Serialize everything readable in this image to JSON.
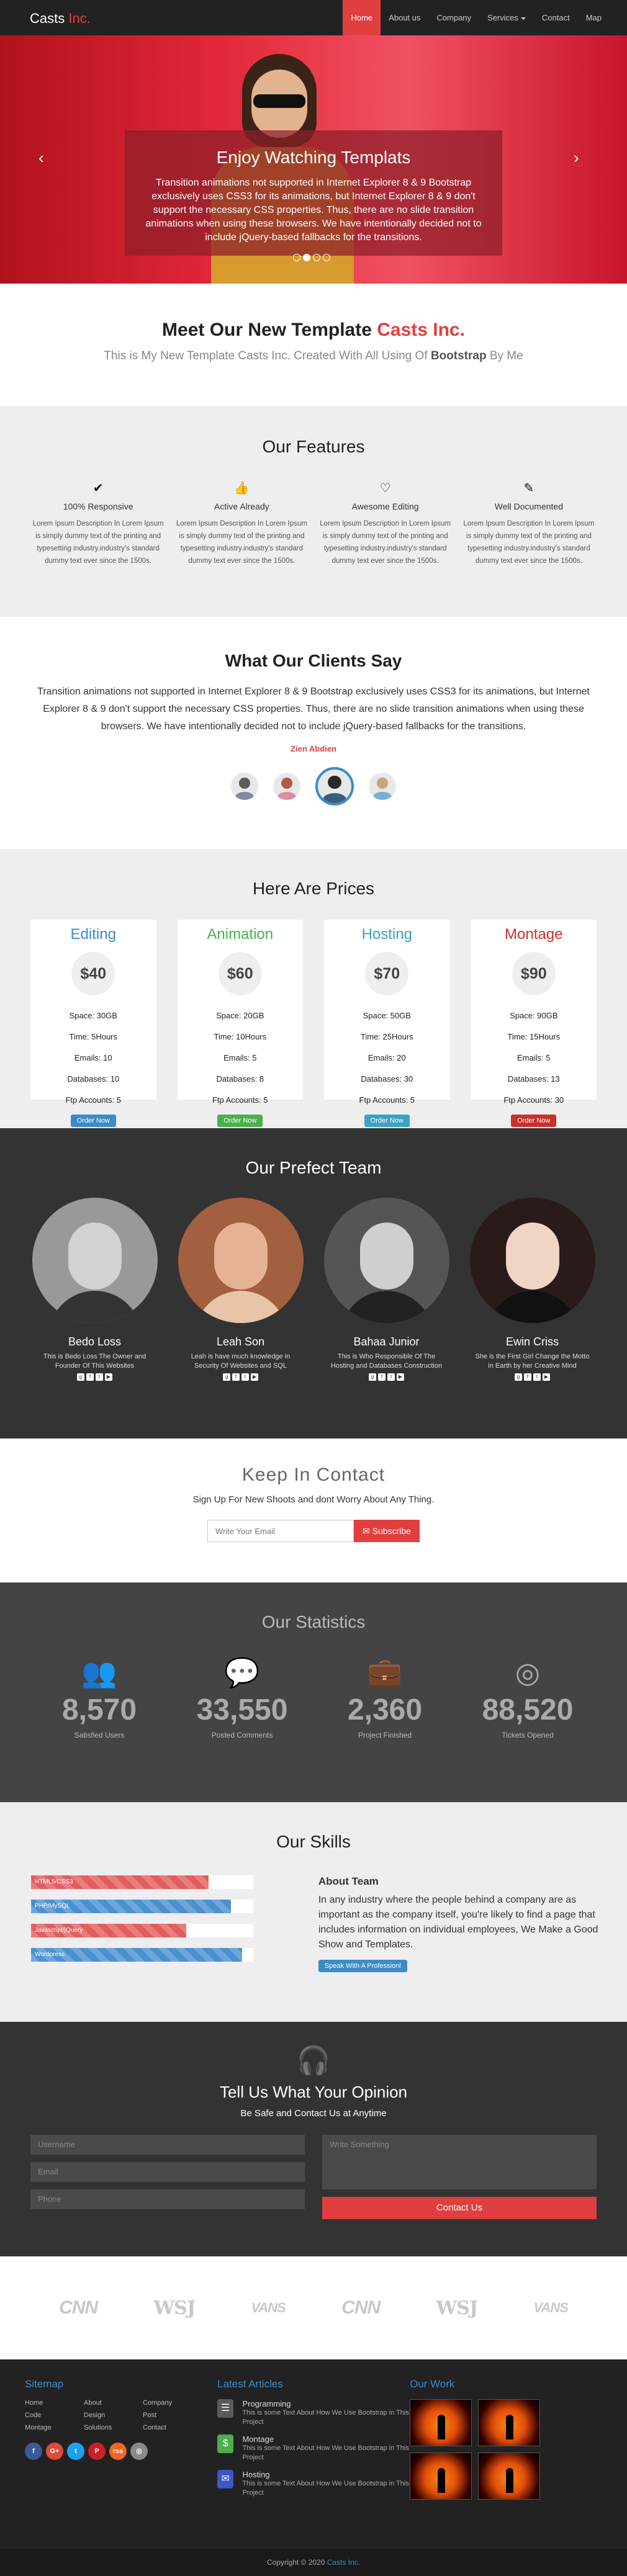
{
  "nav": {
    "brand_main": "Casts ",
    "brand_accent": "Inc.",
    "items": [
      "Home",
      "About us",
      "Company",
      "Services",
      "Contact",
      "Map"
    ]
  },
  "hero": {
    "title": "Enjoy Watching Templats",
    "text": "Transition animations not supported in Internet Explorer 8 & 9 Bootstrap exclusively uses CSS3 for its animations, but Internet Explorer 8 & 9 don't support the necessary CSS properties. Thus, there are no slide transition animations when using these browsers. We have intentionally decided not to include jQuery-based fallbacks for the transitions.",
    "prev": "‹",
    "next": "›"
  },
  "meet": {
    "title": "Meet Our New Template ",
    "title_accent": "Casts Inc.",
    "sub_a": "This is My New Template Casts Inc. Created With All Using Of ",
    "sub_b": "Bootstrap",
    "sub_c": " By Me"
  },
  "features": {
    "title": "Our Features",
    "items": [
      {
        "icon": "✔",
        "title": "100% Responsive",
        "text": "Lorem Ipsum Description In Lorem Ipsum is simply dummy text of the printing and typesetting industry.industry's standard dummy text ever since the 1500s."
      },
      {
        "icon": "👍",
        "title": "Active Already",
        "text": "Lorem Ipsum Description In Lorem Ipsum is simply dummy text of the printing and typesetting industry.industry's standard dummy text ever since the 1500s."
      },
      {
        "icon": "♡",
        "title": "Awesome Editing",
        "text": "Lorem Ipsum Description In Lorem Ipsum is simply dummy text of the printing and typesetting industry.industry's standard dummy text ever since the 1500s."
      },
      {
        "icon": "✎",
        "title": "Well Documented",
        "text": "Lorem Ipsum Description In Lorem Ipsum is simply dummy text of the printing and typesetting industry.industry's standard dummy text ever since the 1500s."
      }
    ]
  },
  "clients": {
    "title": "What Our Clients Say",
    "text": "Transition animations not supported in Internet Explorer 8 & 9 Bootstrap exclusively uses CSS3 for its animations, but Internet Explorer 8 & 9 don't support the necessary CSS properties. Thus, there are no slide transition animations when using these browsers. We have intentionally decided not to include jQuery-based fallbacks for the transitions.",
    "author": "Zien Abdien"
  },
  "prices": {
    "title": "Here Are Prices",
    "plans": [
      {
        "name": "Editing",
        "color": "#3a8cc7",
        "price": "$40",
        "rows": [
          "Space: 30GB",
          "Time: 5Hours",
          "Emails: 10",
          "Databases: 10",
          "Ftp Accounts: 5"
        ],
        "button": "Order Now"
      },
      {
        "name": "Animation",
        "color": "#4cae4c",
        "price": "$60",
        "rows": [
          "Space: 20GB",
          "Time: 10Hours",
          "Emails: 5",
          "Databases: 8",
          "Ftp Accounts: 5"
        ],
        "button": "Order Now"
      },
      {
        "name": "Hosting",
        "color": "#3aa3c2",
        "price": "$70",
        "rows": [
          "Space: 50GB",
          "Time: 25Hours",
          "Emails: 20",
          "Databases: 30",
          "Ftp Accounts: 5"
        ],
        "button": "Order Now"
      },
      {
        "name": "Montage",
        "color": "#c9302c",
        "price": "$90",
        "rows": [
          "Space: 90GB",
          "Time: 15Hours",
          "Emails: 5",
          "Databases: 13",
          "Ftp Accounts: 30"
        ],
        "button": "Order Now"
      }
    ]
  },
  "team": {
    "title": "Our Prefect Team",
    "members": [
      {
        "name": "Bedo Loss",
        "bio": "This is Bedo Loss The Owner and Founder Of This Websites"
      },
      {
        "name": "Leah Son",
        "bio": "Leah is have much knowledge in Security Of Websites and SQL"
      },
      {
        "name": "Bahaa Junior",
        "bio": "This is Who Responsible Of The Hosting and Databases Construction"
      },
      {
        "name": "Ewin Criss",
        "bio": "She is the First Girl Change the Motto in Earth by her Creative Mind"
      }
    ]
  },
  "contact": {
    "title": "Keep In Contact",
    "text": "Sign Up For New Shoots and dont Worry About Any Thing.",
    "placeholder": "Write Your Email",
    "button": "Subscribe"
  },
  "stats": {
    "title": "Our Statistics",
    "items": [
      {
        "icon": "users-icon",
        "num": "8,570",
        "label": "Satisfied Users"
      },
      {
        "icon": "comments-icon",
        "num": "33,550",
        "label": "Posted Comments"
      },
      {
        "icon": "briefcase-icon",
        "num": "2,360",
        "label": "Project Finished"
      },
      {
        "icon": "lifebuoy-icon",
        "num": "88,520",
        "label": "Tickets Opened"
      }
    ]
  },
  "skills": {
    "title": "Our Skills",
    "bars": [
      {
        "label": "HTML5/CSS3",
        "percent": 80,
        "color": "#e35d5d"
      },
      {
        "label": "PHP/MySQL",
        "percent": 90,
        "color": "#4a90d2"
      },
      {
        "label": "Javascript/jQuery",
        "percent": 70,
        "color": "#e35d5d"
      },
      {
        "label": "Wordpress",
        "percent": 95,
        "color": "#4a90d2"
      }
    ],
    "about_title": "About Team",
    "about_text": "In any industry where the people behind a company are as important as the company itself, you're likely to find a page that includes information on individual employees, We Make a Good Show and Templates.",
    "about_button": "Speak With A Professionl"
  },
  "opinion": {
    "title": "Tell Us What Your Opinion",
    "sub": "Be Safe and Contact Us at Anytime",
    "username": "Username",
    "email": "Email",
    "phone": "Phone",
    "message": "Write Something",
    "button": "Contact Us"
  },
  "logos": [
    "CNN",
    "WSJ",
    "VANS",
    "CNN",
    "WSJ",
    "VANS"
  ],
  "footer": {
    "sitemap_title": "Sitemap",
    "links": [
      "Home",
      "About",
      "Company",
      "Code",
      "Design",
      "Post",
      "Montage",
      "Solutions",
      "Contact"
    ],
    "social": [
      {
        "t": "f",
        "c": "#3b5998"
      },
      {
        "t": "G+",
        "c": "#dd4b39"
      },
      {
        "t": "t",
        "c": "#1da1f2"
      },
      {
        "t": "P",
        "c": "#cb2027"
      },
      {
        "t": "rss",
        "c": "#f26522"
      },
      {
        "t": "◎",
        "c": "#8a8a8a"
      }
    ],
    "articles_title": "Latest Articles",
    "articles": [
      {
        "title": "Programming",
        "text": "This is some Text About How We Use Bootstrap in This Project",
        "color": "#5a5a5a",
        "icon": "☰"
      },
      {
        "title": "Montage",
        "text": "This is some Text About How We Use Bootstrap in This Project",
        "color": "#4cae4c",
        "icon": "$"
      },
      {
        "title": "Hosting",
        "text": "This is some Text About How We Use Bootstrap in This Project",
        "color": "#3a56c7",
        "icon": "✉"
      }
    ],
    "work_title": "Our Work",
    "copy_a": "Copyright © 2020 ",
    "copy_b": "Casts Inc."
  }
}
